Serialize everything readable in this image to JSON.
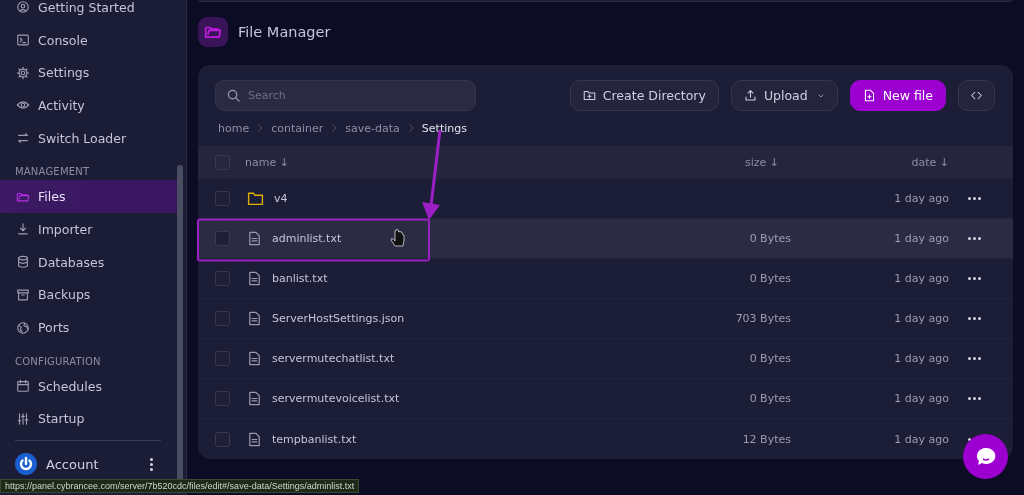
{
  "sidebar": {
    "sections": [
      {
        "items": [
          {
            "label": "Getting Started",
            "selected": false
          },
          {
            "label": "Console",
            "selected": false
          },
          {
            "label": "Settings",
            "selected": false
          },
          {
            "label": "Activity",
            "selected": false
          },
          {
            "label": "Switch Loader",
            "selected": false
          }
        ]
      },
      {
        "title": "MANAGEMENT",
        "items": [
          {
            "label": "Files",
            "selected": true
          },
          {
            "label": "Importer",
            "selected": false
          },
          {
            "label": "Databases",
            "selected": false
          },
          {
            "label": "Backups",
            "selected": false
          },
          {
            "label": "Ports",
            "selected": false
          }
        ]
      },
      {
        "title": "CONFIGURATION",
        "items": [
          {
            "label": "Schedules",
            "selected": false
          },
          {
            "label": "Startup",
            "selected": false
          }
        ]
      }
    ],
    "account": {
      "label": "Account"
    }
  },
  "page": {
    "title": "File Manager"
  },
  "toolbar": {
    "search": {
      "placeholder": "Search"
    },
    "buttons": [
      {
        "kind": "create",
        "label": "Create Directory"
      },
      {
        "kind": "upload",
        "label": "Upload"
      },
      {
        "kind": "new",
        "label": "New file"
      },
      {
        "kind": "code"
      }
    ]
  },
  "breadcrumb": [
    {
      "label": "home",
      "current": false
    },
    {
      "label": "container",
      "current": false
    },
    {
      "label": "save-data",
      "current": false
    },
    {
      "label": "Settings",
      "current": true
    }
  ],
  "table": {
    "select_all": {
      "checked": false
    },
    "columns": [
      "name ↓",
      "size ↓",
      "date ↓"
    ],
    "rows": [
      {
        "kind": "folder",
        "name": "v4",
        "date": "1 day ago",
        "highlighted": false,
        "checked": false
      },
      {
        "kind": "file",
        "name": "adminlist.txt",
        "size": "0 Bytes",
        "date": "1 day ago",
        "highlighted": true,
        "checked": false
      },
      {
        "kind": "file",
        "name": "banlist.txt",
        "size": "0 Bytes",
        "date": "1 day ago",
        "highlighted": false,
        "checked": false
      },
      {
        "kind": "file",
        "name": "ServerHostSettings.json",
        "size": "703 Bytes",
        "date": "1 day ago",
        "highlighted": false,
        "checked": false
      },
      {
        "kind": "file",
        "name": "servermutechatlist.txt",
        "size": "0 Bytes",
        "date": "1 day ago",
        "highlighted": false,
        "checked": false
      },
      {
        "kind": "file",
        "name": "servermutevoicelist.txt",
        "size": "0 Bytes",
        "date": "1 day ago",
        "highlighted": false,
        "checked": false
      },
      {
        "kind": "file",
        "name": "tempbanlist.txt",
        "size": "12 Bytes",
        "date": "1 day ago",
        "highlighted": false,
        "checked": false
      }
    ]
  },
  "status_bar": {
    "url": "https://panel.cybrancee.com/server/7b520cdc/files/edit#/save-data/Settings/adminlist.txt"
  }
}
